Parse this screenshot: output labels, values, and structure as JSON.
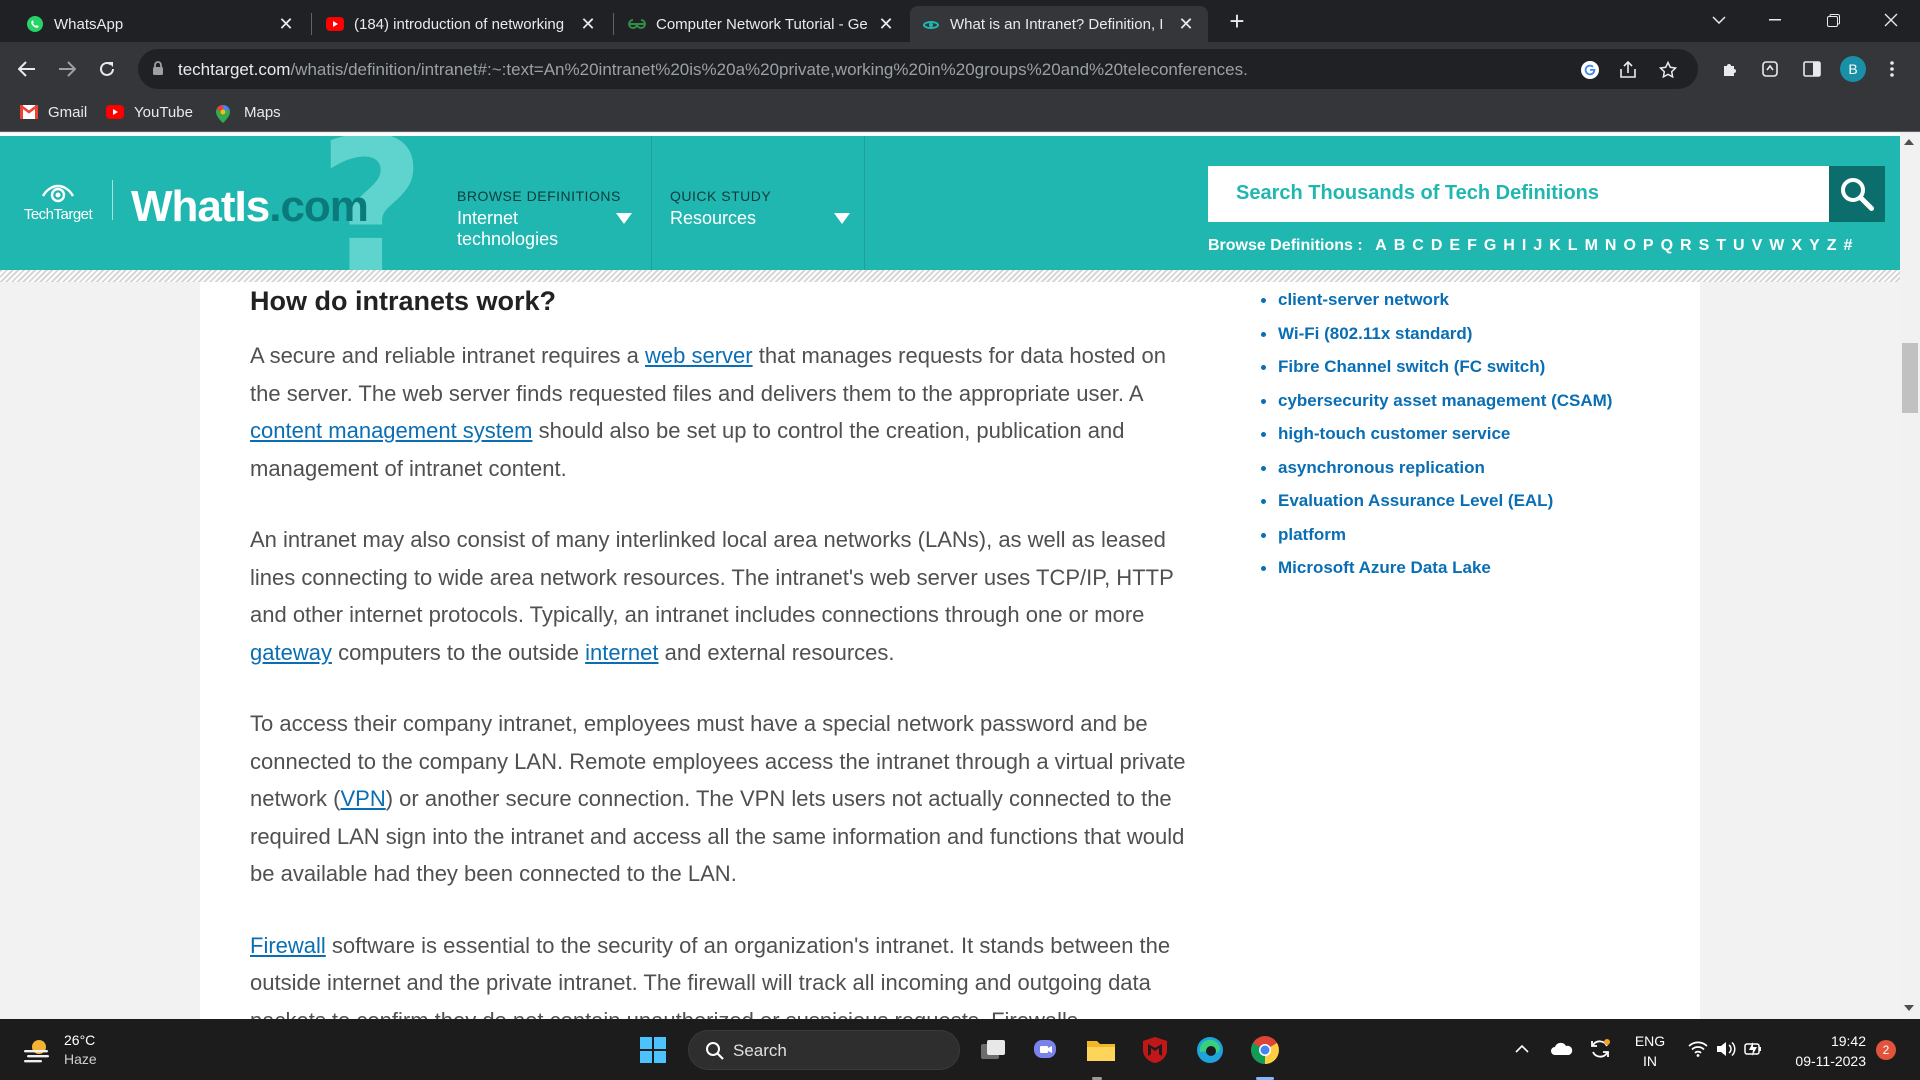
{
  "browser": {
    "tabs": [
      {
        "title": "WhatsApp",
        "icon": "whatsapp-icon"
      },
      {
        "title": "(184) introduction of networking",
        "icon": "youtube-icon"
      },
      {
        "title": "Computer Network Tutorial - Ge",
        "icon": "geeksforgeeks-icon"
      },
      {
        "title": "What is an Intranet? Definition, I",
        "icon": "techtarget-icon",
        "active": true
      }
    ],
    "new_tab": "+",
    "url_host": "techtarget.com",
    "url_path": "/whatis/definition/intranet#:~:text=An%20intranet%20is%20a%20private,working%20in%20groups%20and%20teleconferences.",
    "profile_initial": "B",
    "bookmarks": [
      {
        "label": "Gmail",
        "icon": "gmail-icon"
      },
      {
        "label": "YouTube",
        "icon": "youtube-icon"
      },
      {
        "label": "Maps",
        "icon": "maps-icon"
      }
    ]
  },
  "site": {
    "techtarget_label": "TechTarget",
    "brand_main": "WhatIs",
    "brand_suffix": ".com",
    "question_mark": "?",
    "nav": [
      {
        "small": "BROWSE DEFINITIONS",
        "big_line1": "Internet",
        "big_line2": "technologies"
      },
      {
        "small": "QUICK STUDY",
        "big_line1": "Resources",
        "big_line2": ""
      }
    ],
    "search_placeholder": "Search Thousands of Tech Definitions",
    "browse_label": "Browse Definitions :",
    "letters": [
      "A",
      "B",
      "C",
      "D",
      "E",
      "F",
      "G",
      "H",
      "I",
      "J",
      "K",
      "L",
      "M",
      "N",
      "O",
      "P",
      "Q",
      "R",
      "S",
      "T",
      "U",
      "V",
      "W",
      "X",
      "Y",
      "Z",
      "#"
    ]
  },
  "article": {
    "heading": "How do intranets work?",
    "p1": {
      "t1": "A secure and reliable intranet requires a ",
      "l1": "web server",
      "t2": " that manages requests for data hosted on the server. The web server finds requested files and delivers them to the appropriate user. A ",
      "l2": "content management system",
      "t3": " should also be set up to control the creation, publication and management of intranet content."
    },
    "p2": {
      "t1": "An intranet may also consist of many interlinked local area networks (LANs), as well as leased lines connecting to wide area network resources. The intranet's web server uses TCP/IP, HTTP and other internet protocols. Typically, an intranet includes connections through one or more ",
      "l1": "gateway",
      "t2": " computers to the outside ",
      "l2": "internet",
      "t3": " and external resources."
    },
    "p3": {
      "t1": "To access their company intranet, employees must have a special network password and be connected to the company LAN. Remote employees access the intranet through a virtual private network (",
      "l1": "VPN",
      "t2": ") or another secure connection. The VPN lets users not actually connected to the required LAN sign into the intranet and access all the same information and functions that would be available had they been connected to the LAN."
    },
    "p4": {
      "l1": "Firewall",
      "t1": " software is essential to the security of an organization's intranet. It stands between the outside internet and the private intranet. The firewall will track all incoming and outgoing data packets to confirm they do not contain unauthorized or suspicious requests. Firewalls"
    }
  },
  "sidebar": {
    "links": [
      "client-server network",
      "Wi-Fi (802.11x standard)",
      "Fibre Channel switch (FC switch)",
      "cybersecurity asset management (CSAM)",
      "high-touch customer service",
      "asynchronous replication",
      "Evaluation Assurance Level (EAL)",
      "platform",
      "Microsoft Azure Data Lake"
    ]
  },
  "taskbar": {
    "temperature": "26°C",
    "weather_condition": "Haze",
    "search_label": "Search",
    "lang_line1": "ENG",
    "lang_line2": "IN",
    "time": "19:42",
    "date": "09-11-2023",
    "notifications": "2"
  },
  "colors": {
    "header_teal": "#21b7b1",
    "search_button": "#0b6e6c",
    "link_blue": "#0a6eb4",
    "chrome_dark": "#202124"
  }
}
